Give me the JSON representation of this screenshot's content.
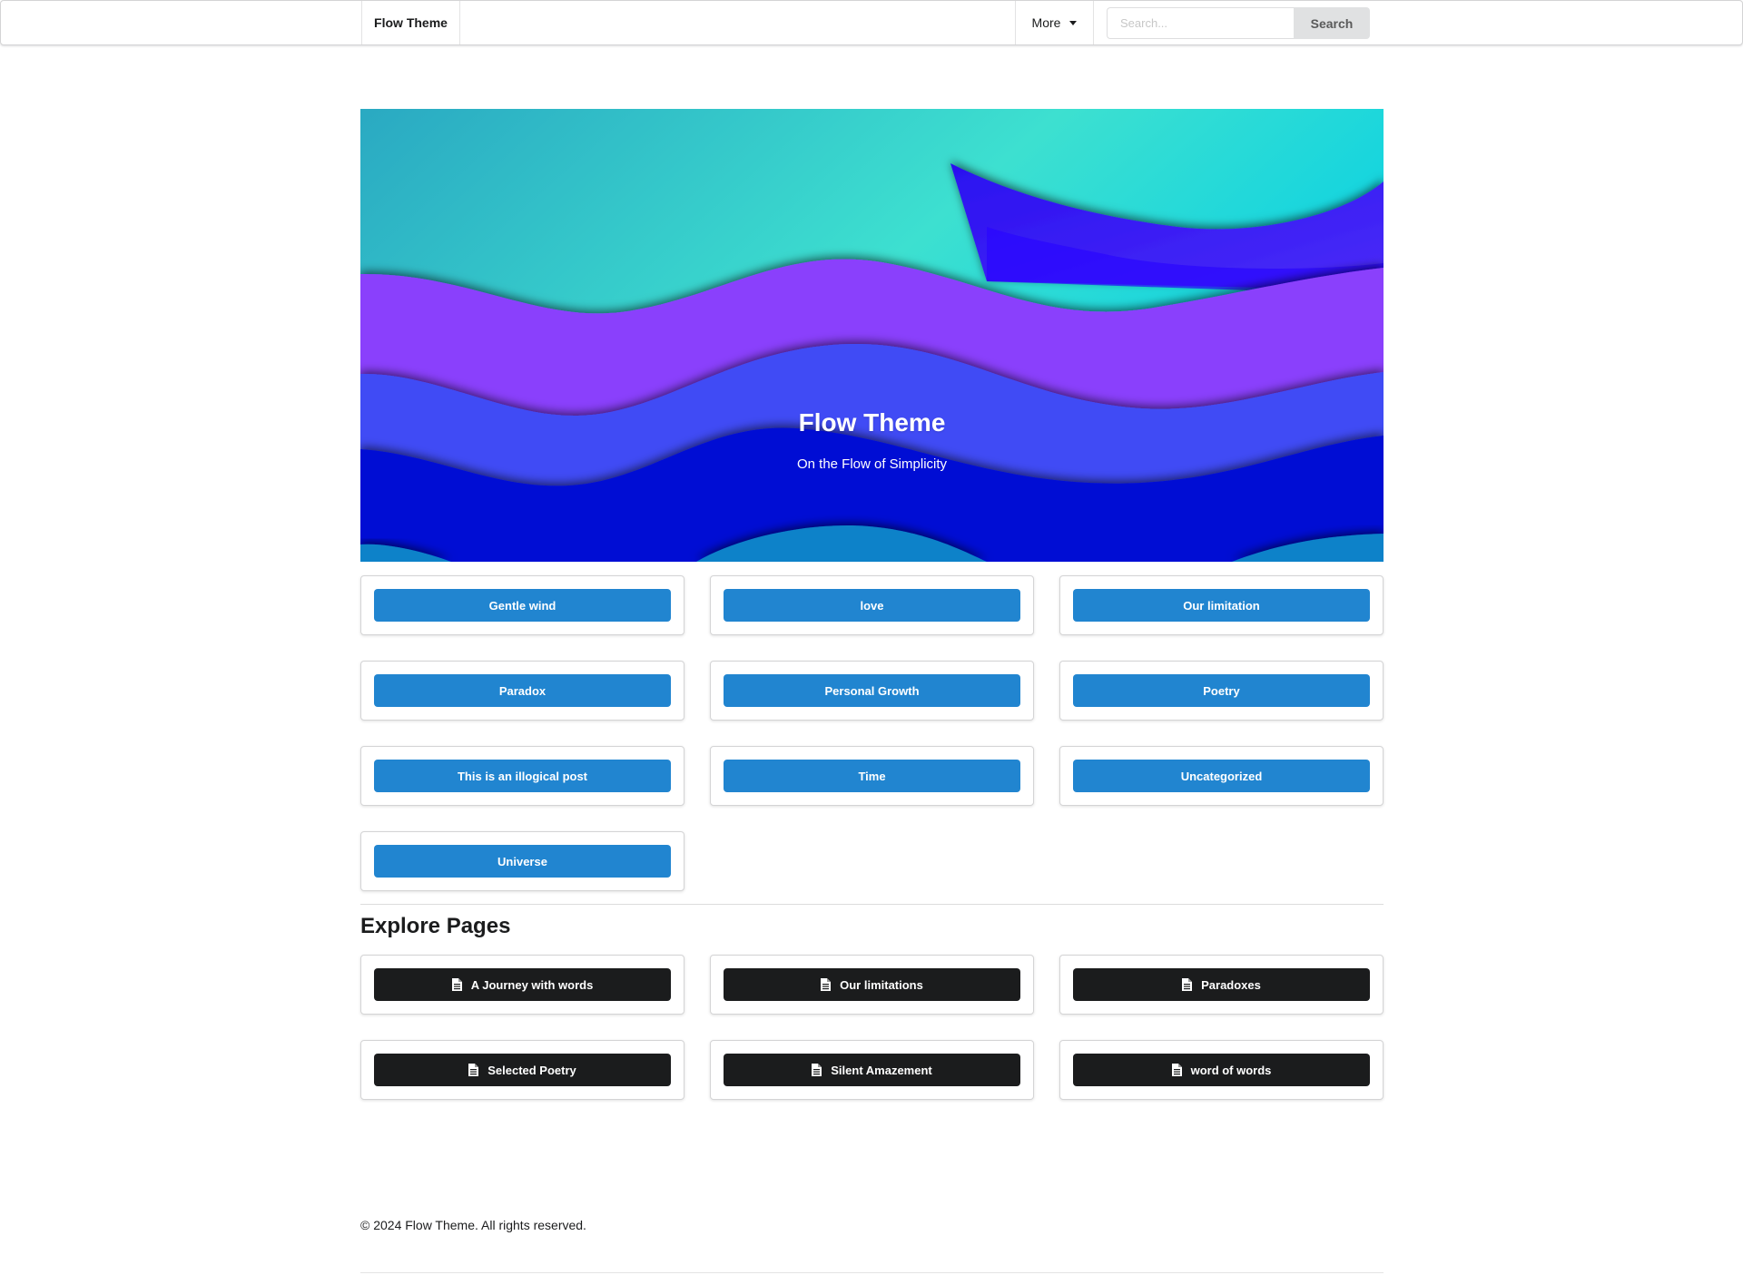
{
  "nav": {
    "brand": "Flow Theme",
    "more_label": "More",
    "search_placeholder": "Search...",
    "search_button": "Search"
  },
  "hero": {
    "title": "Flow Theme",
    "subtitle": "On the Flow of Simplicity",
    "colors": {
      "sky_top": "#2aa9c2",
      "sky_mid": "#3de0d0",
      "purple_wave": "#8a3ffc",
      "blue_wave": "#3f4bf5",
      "deep_wave": "#0511d4",
      "bottom_wave": "#0a82c9",
      "sail": "#3a1cf5"
    }
  },
  "categories": [
    {
      "label": "Gentle wind"
    },
    {
      "label": "love"
    },
    {
      "label": "Our limitation"
    },
    {
      "label": "Paradox"
    },
    {
      "label": "Personal Growth"
    },
    {
      "label": "Poetry"
    },
    {
      "label": "This is an illogical post"
    },
    {
      "label": "Time"
    },
    {
      "label": "Uncategorized"
    },
    {
      "label": "Universe"
    }
  ],
  "pages_section": {
    "heading": "Explore Pages",
    "icon": "file-icon",
    "items": [
      {
        "label": "A Journey with words"
      },
      {
        "label": "Our limitations"
      },
      {
        "label": "Paradoxes"
      },
      {
        "label": "Selected Poetry"
      },
      {
        "label": "Silent Amazement"
      },
      {
        "label": "word of words"
      }
    ]
  },
  "footer": {
    "text": "© 2024 Flow Theme. All rights reserved."
  },
  "colors": {
    "category_button": "#2185d0",
    "page_button": "#1b1c1d"
  }
}
